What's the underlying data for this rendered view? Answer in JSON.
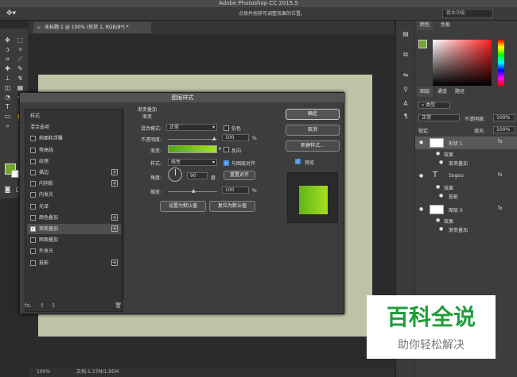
{
  "app": {
    "title": "Adobe Photoshop CC 2015.5",
    "hint": "点按并拖移可调整效果的位置。",
    "workspace": "基本功能"
  },
  "document": {
    "tab_title": "未标题-1 @ 100% (形状 1, RGB/8*) *",
    "zoom": "100%",
    "doc_info": "文档:1.37M/1.95M"
  },
  "color_panel": {
    "tabs": [
      "颜色",
      "色板"
    ],
    "accent": "#73a531"
  },
  "layers_panel": {
    "tabs": [
      "图层",
      "通道",
      "路径"
    ],
    "filter": "类型",
    "blend_mode": "正常",
    "opacity_label": "不透明度:",
    "opacity_value": "100%",
    "lock_label": "锁定:",
    "fill_label": "填充:",
    "fill_value": "100%",
    "layers": [
      {
        "name": "形状 1",
        "fx": "fx",
        "effects_label": "效果",
        "effect": "渐变叠加"
      },
      {
        "name": "Sogou",
        "fx": "fx",
        "effects_label": "效果",
        "effect": "投影"
      },
      {
        "name": "图层 0",
        "fx": "fx",
        "effects_label": "效果",
        "effect": "渐变叠加"
      }
    ]
  },
  "dialog": {
    "title": "图层样式",
    "styles": [
      {
        "label": "样式",
        "checkbox": false,
        "plus": false
      },
      {
        "label": "混合选项",
        "checkbox": false,
        "plus": false
      },
      {
        "label": "斜面和浮雕",
        "checkbox": true,
        "checked": false,
        "plus": false
      },
      {
        "label": "等高线",
        "checkbox": true,
        "checked": false,
        "plus": false
      },
      {
        "label": "纹理",
        "checkbox": true,
        "checked": false,
        "plus": false
      },
      {
        "label": "描边",
        "checkbox": true,
        "checked": false,
        "plus": true
      },
      {
        "label": "内阴影",
        "checkbox": true,
        "checked": false,
        "plus": true
      },
      {
        "label": "内发光",
        "checkbox": true,
        "checked": false,
        "plus": false
      },
      {
        "label": "光泽",
        "checkbox": true,
        "checked": false,
        "plus": false
      },
      {
        "label": "颜色叠加",
        "checkbox": true,
        "checked": false,
        "plus": true
      },
      {
        "label": "渐变叠加",
        "checkbox": true,
        "checked": true,
        "plus": true
      },
      {
        "label": "图案叠加",
        "checkbox": true,
        "checked": false,
        "plus": false
      },
      {
        "label": "外发光",
        "checkbox": true,
        "checked": false,
        "plus": false
      },
      {
        "label": "投影",
        "checkbox": true,
        "checked": false,
        "plus": true
      }
    ],
    "section_title": "渐变叠加",
    "section_subtitle": "渐变",
    "blend_mode_label": "混合模式:",
    "blend_mode_value": "正常",
    "dither_label": "仿色",
    "opacity_label": "不透明度:",
    "opacity_value": "100",
    "opacity_unit": "%",
    "gradient_label": "渐变:",
    "reverse_label": "反向",
    "style_label": "样式:",
    "style_value": "线性",
    "align_label": "与图层对齐",
    "angle_label": "角度:",
    "angle_value": "90",
    "angle_unit": "度",
    "reset_align_label": "重置对齐",
    "scale_label": "缩放:",
    "scale_value": "100",
    "scale_unit": "%",
    "set_default_label": "设置为默认值",
    "reset_default_label": "复位为默认值",
    "ok_label": "确定",
    "cancel_label": "取消",
    "new_style_label": "新建样式...",
    "preview_label": "预览",
    "footer_fx": "fx.",
    "gradient_start": "#4da610",
    "gradient_end": "#a6e61c"
  },
  "watermark": {
    "title": "百科全说",
    "subtitle": "助你轻松解决"
  }
}
